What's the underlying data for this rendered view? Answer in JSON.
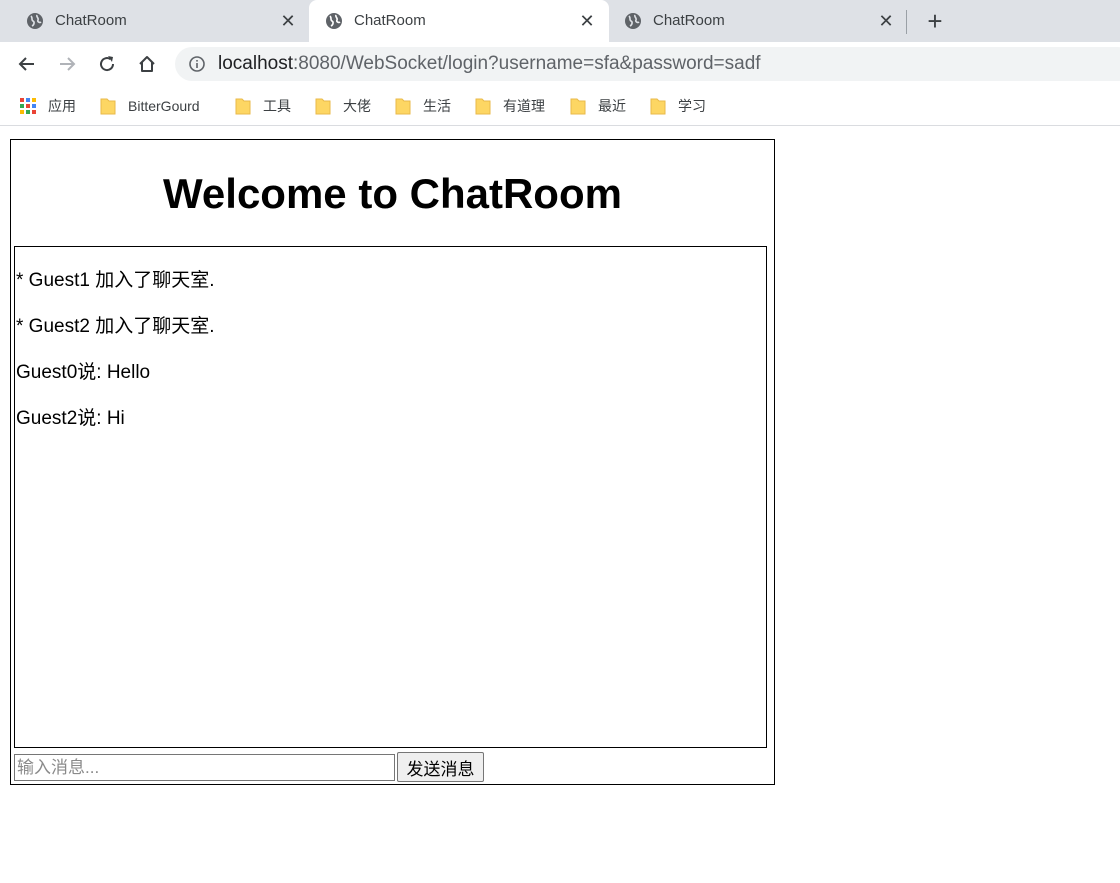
{
  "browser": {
    "tabs": [
      {
        "title": "ChatRoom",
        "active": false
      },
      {
        "title": "ChatRoom",
        "active": true
      },
      {
        "title": "ChatRoom",
        "active": false
      }
    ],
    "url": {
      "host": "localhost",
      "rest": ":8080/WebSocket/login?username=sfa&password=sadf"
    },
    "bookmarks": [
      {
        "label": "应用",
        "icon": "apps-grid-icon"
      },
      {
        "label": "BitterGourd",
        "icon": "folder-icon"
      },
      {
        "label": "工具",
        "icon": "folder-icon"
      },
      {
        "label": "大佬",
        "icon": "folder-icon"
      },
      {
        "label": "生活",
        "icon": "folder-icon"
      },
      {
        "label": "有道理",
        "icon": "folder-icon"
      },
      {
        "label": "最近",
        "icon": "folder-icon"
      },
      {
        "label": "学习",
        "icon": "folder-icon"
      }
    ],
    "colors": {
      "tabstrip": "#dee1e6",
      "omnibox": "#f1f3f4",
      "folder": "#fdd663"
    }
  },
  "page": {
    "title": "Welcome to ChatRoom",
    "messages": [
      "* Guest1 加入了聊天室.",
      "* Guest2 加入了聊天室.",
      "Guest0说: Hello",
      "Guest2说: Hi"
    ],
    "input": {
      "value": "",
      "placeholder": "输入消息..."
    },
    "send_label": "发送消息"
  }
}
